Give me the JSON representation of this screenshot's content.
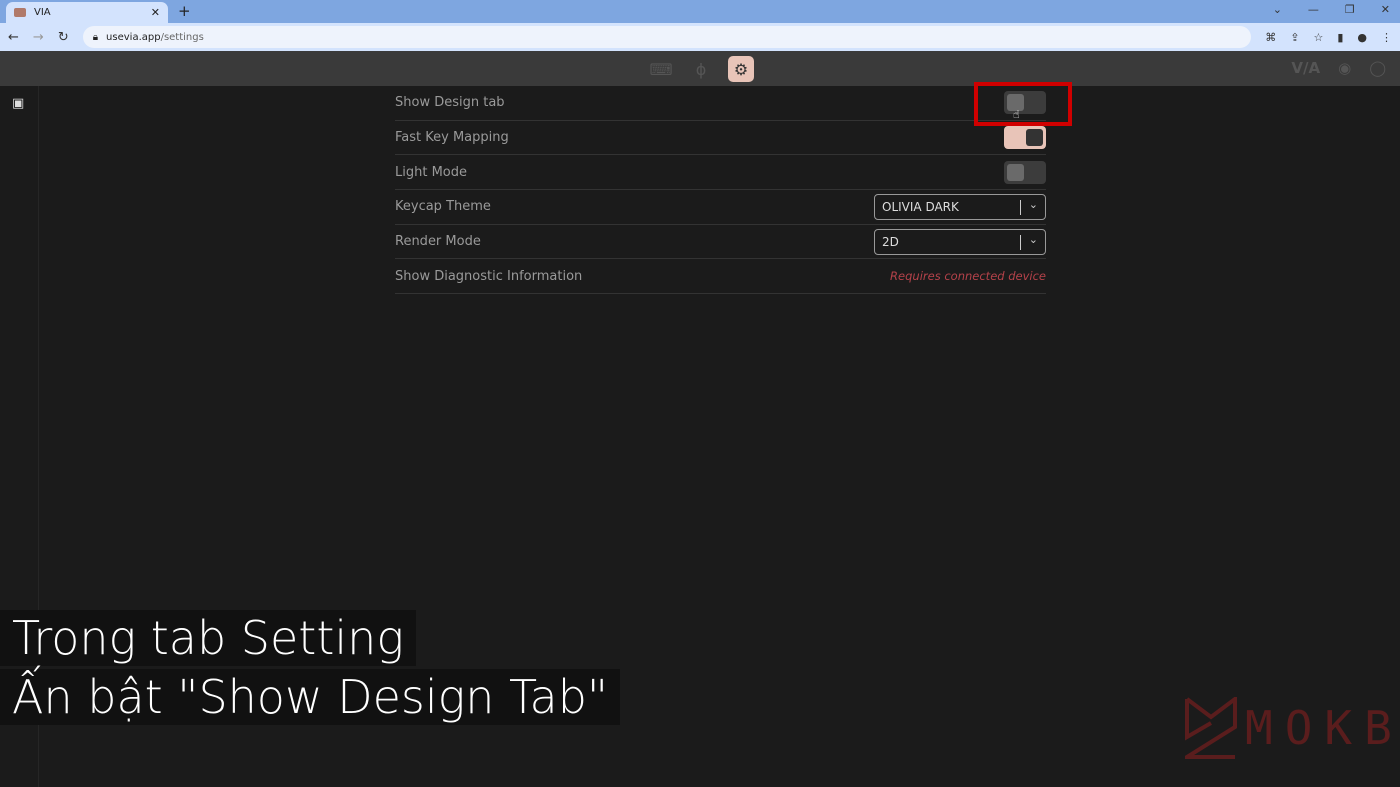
{
  "browser": {
    "tab_title": "VIA",
    "url_domain": "usevia.app",
    "url_path": "/settings"
  },
  "nav": {
    "icons": [
      "keyboard-icon",
      "stethoscope-icon",
      "gear-icon"
    ],
    "active": "gear-icon",
    "brand": "V/A"
  },
  "settings": [
    {
      "label": "Show Design tab",
      "type": "toggle",
      "on": false
    },
    {
      "label": "Fast Key Mapping",
      "type": "toggle",
      "on": true
    },
    {
      "label": "Light Mode",
      "type": "toggle",
      "on": false
    },
    {
      "label": "Keycap Theme",
      "type": "select",
      "value": "OLIVIA DARK"
    },
    {
      "label": "Render Mode",
      "type": "select",
      "value": "2D"
    },
    {
      "label": "Show Diagnostic Information",
      "type": "note",
      "value": "Requires connected device"
    }
  ],
  "caption": {
    "line1": "Trong tab Setting",
    "line2": "Ấn bật \"Show Design Tab\""
  },
  "watermark": "MOKB"
}
